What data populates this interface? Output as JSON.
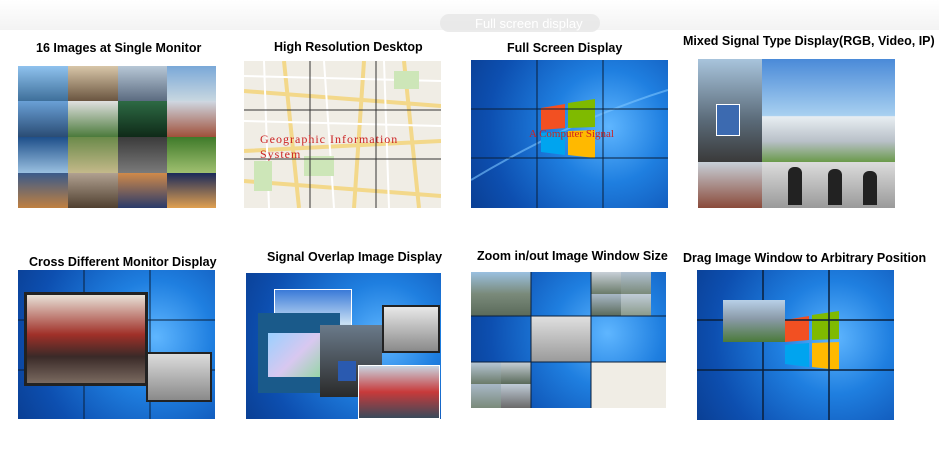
{
  "banner": {
    "ghost_text": "Full screen display"
  },
  "features": [
    {
      "caption": "16 Images at Single Monitor"
    },
    {
      "caption": "High Resolution Desktop",
      "overlay": "Geographic Information System"
    },
    {
      "caption": "Full Screen Display",
      "overlay": "A Computer Signal"
    },
    {
      "caption": "Mixed Signal  Type Display(RGB, Video, IP)"
    },
    {
      "caption": "Cross Different Monitor Display"
    },
    {
      "caption": "Signal Overlap Image Display"
    },
    {
      "caption": "Zoom in/out Image Window Size"
    },
    {
      "caption": "Drag Image Window to Arbitrary Position"
    }
  ],
  "colors": {
    "win_blue": "#1f7fe0",
    "bezel": "#0a1f3a",
    "map_bg": "#f0ede5",
    "overlay_red": "#cc2222"
  }
}
